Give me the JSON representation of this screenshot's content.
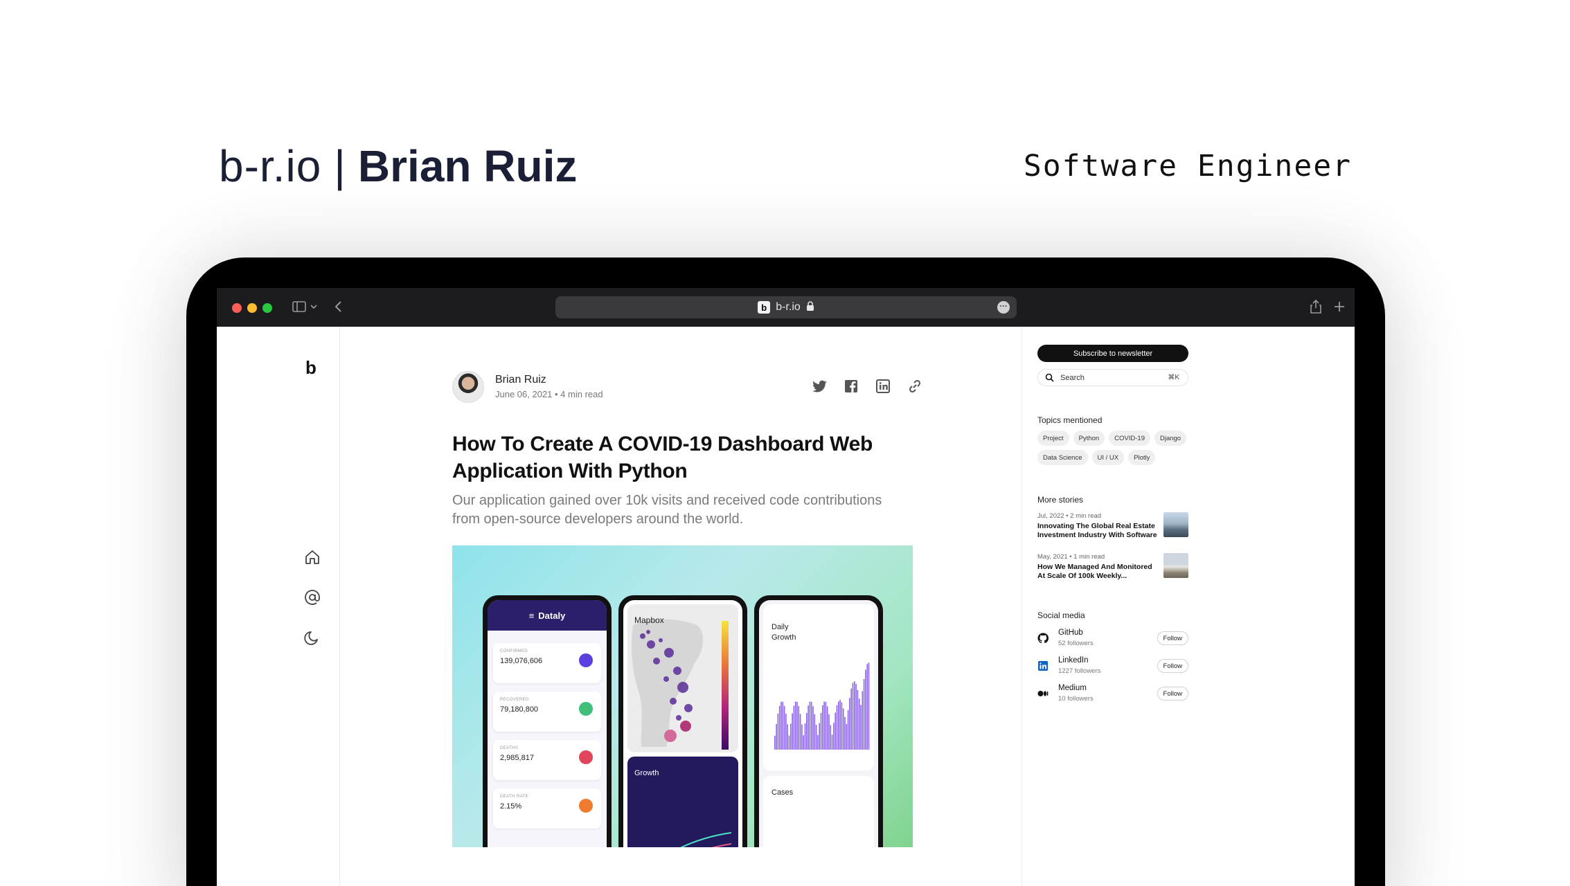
{
  "header": {
    "domain": "b-r.io",
    "separator": "|",
    "name": "Brian Ruiz",
    "role": "Software Engineer"
  },
  "browser": {
    "url": "b-r.io",
    "favicon_letter": "b"
  },
  "rail": {
    "logo": "b"
  },
  "article": {
    "author": "Brian Ruiz",
    "meta": "June 06, 2021 • 4 min read",
    "title": "How To Create A COVID-19 Dashboard Web Application With Python",
    "subtitle": "Our application gained over 10k visits and received code contributions from open-source developers around the world."
  },
  "hero_mockup": {
    "app_name": "Dataly",
    "stats": [
      {
        "label": "CONFIRMED",
        "value": "139,076,606",
        "color": "#5b3fe0"
      },
      {
        "label": "RECOVERED",
        "value": "79,180,800",
        "color": "#3fbf7a"
      },
      {
        "label": "DEATHS",
        "value": "2,985,817",
        "color": "#e0455b"
      },
      {
        "label": "DEATH RATE",
        "value": "2.15%",
        "color": "#f07a2e"
      }
    ],
    "map_title": "Mapbox",
    "growth_title": "Growth",
    "daily_title_1": "Daily",
    "daily_title_2": "Growth",
    "cases_title": "Cases"
  },
  "sidebar": {
    "subscribe_label": "Subscribe to newsletter",
    "search_placeholder": "Search",
    "search_shortcut": "⌘K",
    "topics_title": "Topics mentioned",
    "topics": [
      "Project",
      "Python",
      "COVID-19",
      "Django",
      "Data Science",
      "UI / UX",
      "Plotly"
    ],
    "more_title": "More stories",
    "stories": [
      {
        "meta": "Jul, 2022 • 2 min read",
        "title": "Innovating The Global Real Estate Investment Industry With Software"
      },
      {
        "meta": "May, 2021 • 1 min read",
        "title": "How We Managed And Monitored At Scale Of 100k Weekly..."
      }
    ],
    "social_title": "Social media",
    "socials": [
      {
        "name": "GitHub",
        "followers": "52 followers",
        "button": "Follow"
      },
      {
        "name": "LinkedIn",
        "followers": "1227 followers",
        "button": "Follow"
      },
      {
        "name": "Medium",
        "followers": "10 followers",
        "button": "Follow"
      }
    ]
  },
  "colors": {
    "accent": "#1a1f36",
    "browser_chrome": "#1c1c1e",
    "subscribe_bg": "#111111"
  }
}
